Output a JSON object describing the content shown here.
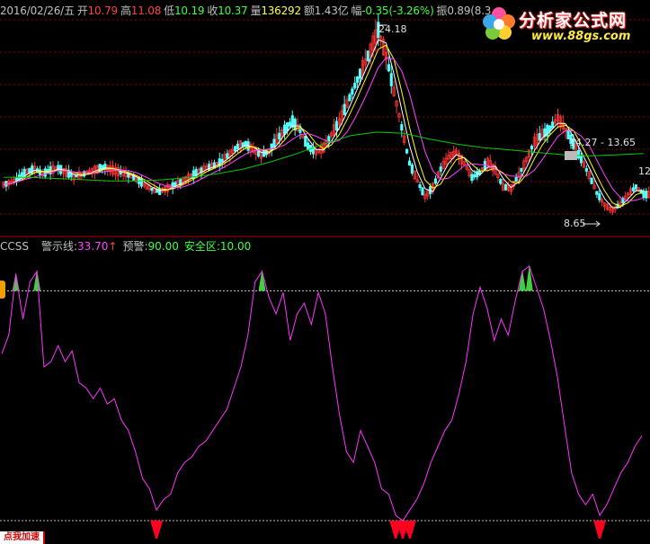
{
  "header": {
    "date": "2016/02/26/五",
    "open_label": "开",
    "open": "10.79",
    "high_label": "高",
    "high": "11.08",
    "low_label": "低",
    "low": "10.19",
    "close_label": "收",
    "close": "10.37",
    "vol_label": "量",
    "vol": "136292",
    "amount_label": "额",
    "amount": "1.43亿",
    "change_label": "幅",
    "change": "-0.35(-3.26%)",
    "amp_label": "振",
    "amp": "0.89(8.3"
  },
  "logo": {
    "title": "分析家公式网",
    "url": "www.88gs.com"
  },
  "indicator": {
    "name": "CCSS",
    "warn_label": "警示线:",
    "warn": "33.70",
    "warn_arrow": "↑",
    "alert_label": "预警:",
    "alert": "90.00",
    "safe_label": "安全区:",
    "safe": "10.00"
  },
  "annotations": {
    "peak": "24.18",
    "range": "14.27 - 13.65",
    "low": "8.65",
    "right_value": "12"
  },
  "button": {
    "label": "点我加速"
  },
  "colors": {
    "up": "#ff3333",
    "down": "#54ffff",
    "ma5": "#ffffff",
    "ma10": "#ffff00",
    "ma20": "#ff44ff",
    "ma60": "#00cc00",
    "ccss": "#ff33ff",
    "warn_fill": "#ff0020",
    "alert_fill": "#44cc44",
    "grid": "#8a0000"
  },
  "chart_data": [
    {
      "type": "candlestick",
      "title": "",
      "series": [
        {
          "name": "price",
          "values": [
            11.2,
            11.4,
            11.8,
            12.3,
            12.5,
            12.1,
            12.4,
            12.6,
            12.2,
            11.9,
            12.0,
            12.3,
            12.5,
            12.7,
            12.4,
            12.2,
            12.0,
            11.7,
            11.2,
            10.8,
            10.6,
            10.9,
            11.2,
            11.5,
            11.9,
            12.3,
            12.6,
            12.8,
            13.2,
            13.8,
            14.4,
            14.6,
            14.1,
            13.7,
            14.0,
            15.0,
            15.8,
            16.5,
            15.7,
            14.4,
            13.9,
            14.3,
            15.4,
            16.5,
            18.0,
            19.5,
            21.0,
            22.5,
            24.18,
            22.0,
            19.0,
            16.0,
            13.0,
            11.5,
            10.2,
            11.0,
            12.5,
            13.5,
            13.9,
            13.0,
            11.8,
            12.2,
            13.1,
            12.4,
            11.0,
            10.9,
            12.0,
            13.3,
            14.8,
            15.4,
            15.9,
            16.8,
            15.8,
            14.6,
            13.3,
            12.0,
            10.5,
            9.5,
            9.0,
            9.6,
            10.4,
            11.0,
            10.37
          ]
        },
        {
          "name": "MA60",
          "values": [
            11.8,
            11.8,
            11.7,
            11.6,
            11.5,
            11.5,
            11.6,
            11.8,
            12.1,
            12.5,
            13.1,
            13.8,
            14.6,
            15.3,
            15.6,
            15.5,
            15.0,
            14.6,
            14.3,
            14.1,
            13.9,
            13.7,
            13.6,
            13.7,
            13.8
          ]
        }
      ]
    },
    {
      "type": "line",
      "title": "",
      "ylim": [
        0,
        100
      ],
      "series": [
        {
          "name": "CCSS",
          "values": [
            65,
            72,
            95,
            78,
            92,
            96,
            60,
            62,
            68,
            62,
            66,
            54,
            52,
            48,
            52,
            46,
            48,
            40,
            36,
            28,
            18,
            14,
            6,
            10,
            12,
            20,
            24,
            26,
            30,
            32,
            36,
            40,
            44,
            52,
            60,
            72,
            92,
            96,
            86,
            80,
            88,
            70,
            80,
            84,
            76,
            88,
            80,
            60,
            42,
            28,
            24,
            36,
            30,
            24,
            14,
            12,
            4,
            2,
            6,
            10,
            16,
            24,
            30,
            36,
            40,
            50,
            62,
            80,
            90,
            82,
            70,
            78,
            72,
            85,
            96,
            98,
            90,
            82,
            70,
            56,
            38,
            20,
            12,
            8,
            12,
            4,
            8,
            14,
            20,
            24,
            30,
            34
          ]
        }
      ],
      "warn": 33.7,
      "alert": 90.0,
      "safe": 10.0
    }
  ]
}
